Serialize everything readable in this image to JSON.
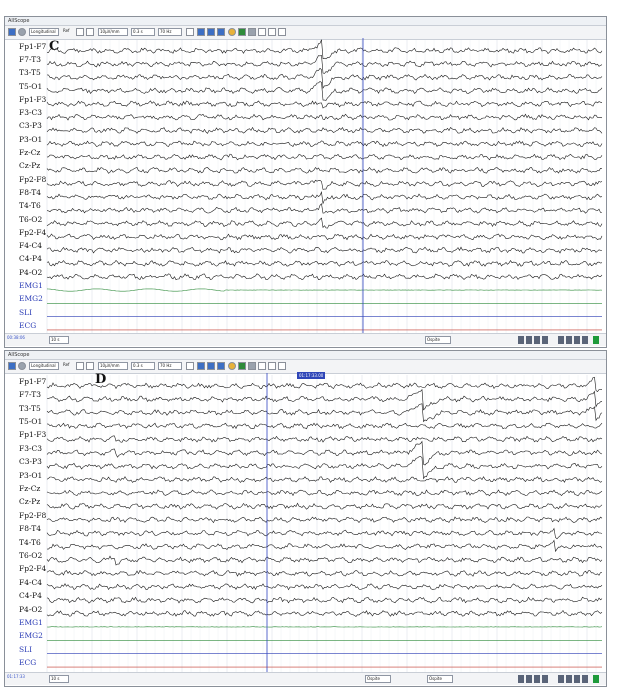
{
  "panels": [
    {
      "id": "C",
      "window_title": "AllScope",
      "panel_letter": "C",
      "montage_select": "Longitudinal",
      "ref_label": "Ref",
      "sensitivity_select": "10µV/mm",
      "timebase_select": "0.3 s",
      "filter_select": "70 Hz",
      "status_text": "00:38:06",
      "page_field": "10 s",
      "marker_label": "Ospite",
      "channels": [
        "Fp1-F7",
        "F7-T3",
        "T3-T5",
        "T5-O1",
        "Fp1-F3",
        "F3-C3",
        "C3-P3",
        "P3-O1",
        "Fz-Cz",
        "Cz-Pz",
        "Fp2-F8",
        "F8-T4",
        "T4-T6",
        "T6-O2",
        "Fp2-F4",
        "F4-C4",
        "C4-P4",
        "P4-O2",
        "EMG1",
        "EMG2",
        "SLI",
        "ECG"
      ],
      "colors": {
        "eeg": "#1a1a1a",
        "emg": "#2e8b3a",
        "sli": "#2b3cb5",
        "ecg": "#c0392b",
        "cursor": "#3045c0",
        "label_blue": "#2b3cb5"
      }
    },
    {
      "id": "D",
      "window_title": "AllScope",
      "panel_letter": "D",
      "montage_select": "Longitudinal",
      "ref_label": "Ref",
      "sensitivity_select": "10µV/mm",
      "timebase_select": "0.3 s",
      "filter_select": "70 Hz",
      "status_text": "01:17:33",
      "page_field": "10 s",
      "cursor_label": "01:17:33.00",
      "marker_label_1": "Ospite",
      "marker_label_2": "Ospite",
      "channels": [
        "Fp1-F7",
        "F7-T3",
        "T3-T5",
        "T5-O1",
        "Fp1-F3",
        "F3-C3",
        "C3-P3",
        "P3-O1",
        "Fz-Cz",
        "Cz-Pz",
        "Fp2-F8",
        "F8-T4",
        "T4-T6",
        "T6-O2",
        "Fp2-F4",
        "F4-C4",
        "C4-P4",
        "P4-O2",
        "EMG1",
        "EMG2",
        "SLI",
        "ECG"
      ],
      "colors": {
        "eeg": "#1a1a1a",
        "emg": "#2e8b3a",
        "sli": "#2b3cb5",
        "ecg": "#c0392b",
        "cursor": "#3045c0",
        "label_blue": "#2b3cb5"
      }
    }
  ],
  "icons": [
    "monitor-icon",
    "settings-icon",
    "wave-icon",
    "pen-icon",
    "list-icon",
    "play-icon",
    "stop-icon",
    "bookmark-icon",
    "print-icon"
  ]
}
